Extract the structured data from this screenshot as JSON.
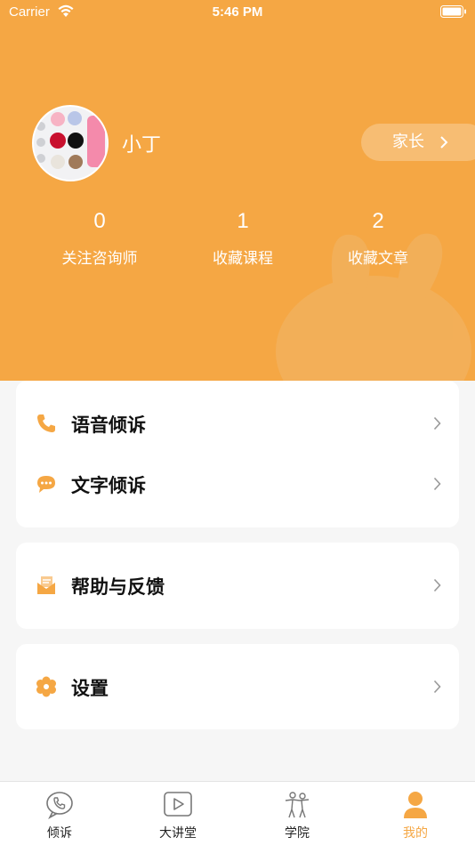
{
  "status_bar": {
    "carrier": "Carrier",
    "time": "5:46 PM"
  },
  "profile": {
    "username": "小丁",
    "role_label": "家长"
  },
  "stats": [
    {
      "value": "0",
      "label": "关注咨询师"
    },
    {
      "value": "1",
      "label": "收藏课程"
    },
    {
      "value": "2",
      "label": "收藏文章"
    }
  ],
  "menu": {
    "voice_confide": "语音倾诉",
    "text_confide": "文字倾诉",
    "help_feedback": "帮助与反馈",
    "settings": "设置"
  },
  "tabbar": {
    "tabs": [
      {
        "label": "倾诉",
        "icon": "phone-bubble-icon"
      },
      {
        "label": "大讲堂",
        "icon": "play-icon"
      },
      {
        "label": "学院",
        "icon": "people-icon"
      },
      {
        "label": "我的",
        "icon": "person-icon"
      }
    ],
    "active_index": 3
  },
  "colors": {
    "accent": "#f5a744",
    "background": "#f6f6f6"
  }
}
